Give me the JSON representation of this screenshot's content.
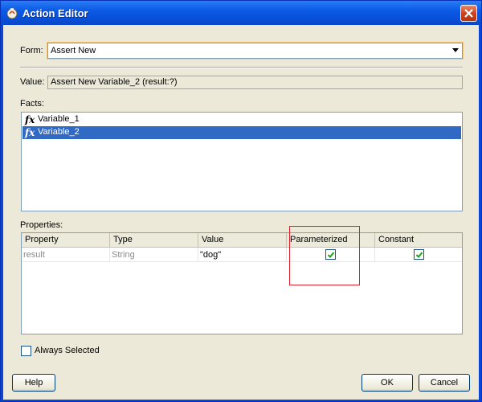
{
  "window": {
    "title": "Action Editor"
  },
  "form": {
    "label": "Form:",
    "value": "Assert New"
  },
  "value": {
    "label": "Value:",
    "text": "Assert New Variable_2 (result:?)"
  },
  "facts": {
    "label": "Facts:",
    "items": [
      {
        "label": "Variable_1",
        "icon": "fx-icon",
        "selected": false
      },
      {
        "label": "Variable_2",
        "icon": "fx-icon",
        "selected": true
      }
    ]
  },
  "properties": {
    "label": "Properties:",
    "columns": [
      "Property",
      "Type",
      "Value",
      "Parameterized",
      "Constant"
    ],
    "rows": [
      {
        "property": "result",
        "type": "String",
        "value": "\"dog\"",
        "parameterized": true,
        "constant": true
      }
    ]
  },
  "always_selected": {
    "label": "Always Selected",
    "checked": false
  },
  "buttons": {
    "help": "Help",
    "ok": "OK",
    "cancel": "Cancel"
  },
  "colors": {
    "title_bar": "#0b5ae5",
    "selection": "#316ac5",
    "highlight_box": "#e0202a"
  }
}
